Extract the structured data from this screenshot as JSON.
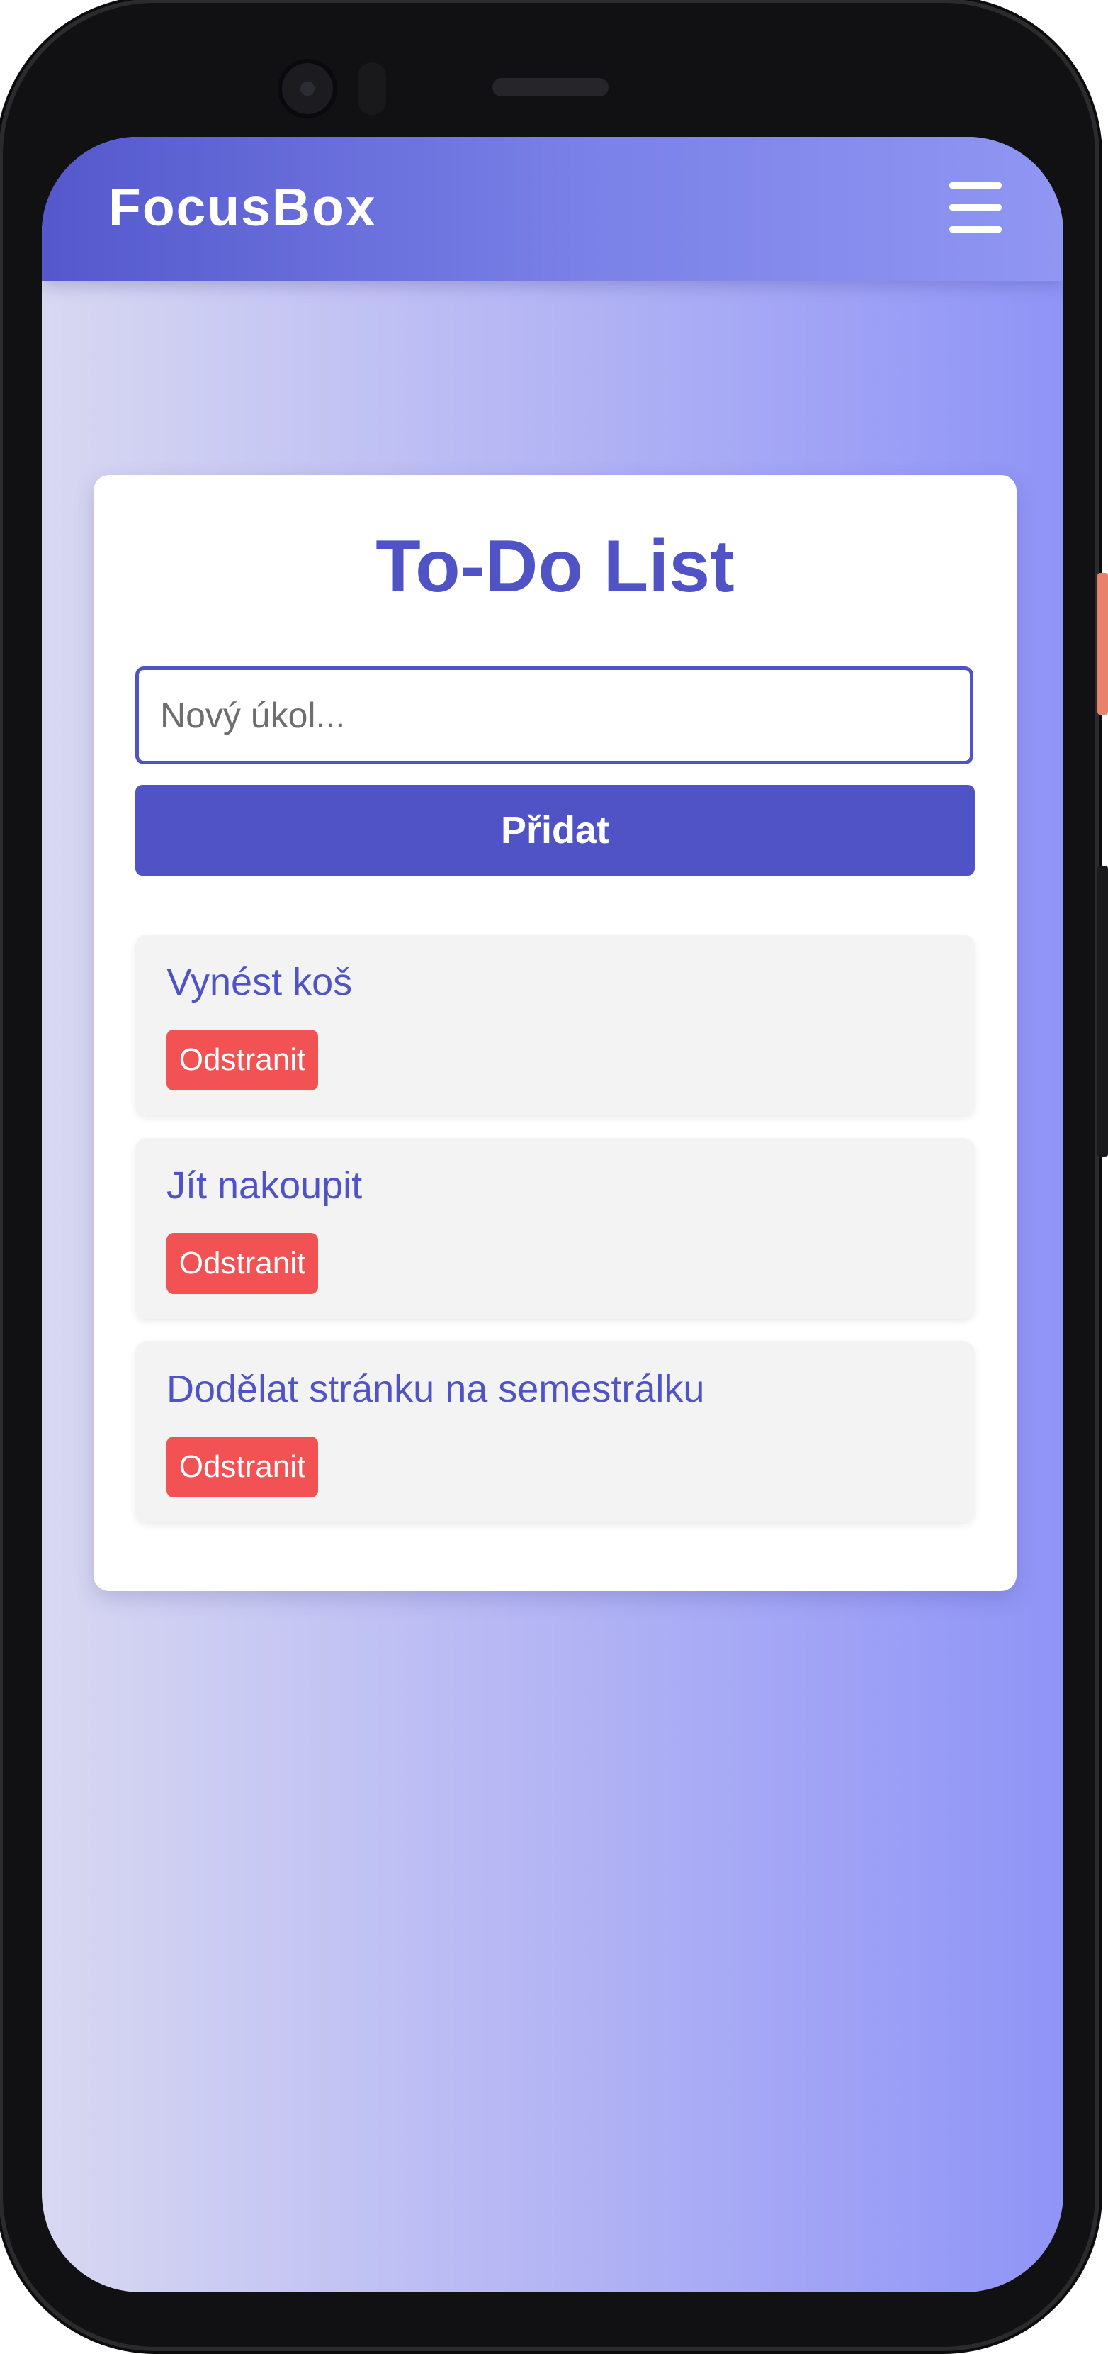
{
  "app": {
    "brand": "FocusBox",
    "menu_icon": "hamburger-menu-icon"
  },
  "todo": {
    "title": "To-Do List",
    "input_placeholder": "Nový úkol...",
    "input_value": "",
    "add_label": "Přidat",
    "delete_label": "Odstranit",
    "tasks": [
      {
        "text": "Vynést koš"
      },
      {
        "text": "Jít nakoupit"
      },
      {
        "text": "Dodělat stránku na semestrálku"
      }
    ]
  },
  "colors": {
    "accent": "#4f53c6",
    "delete": "#f25253",
    "task_bg": "#f3f3f3"
  }
}
